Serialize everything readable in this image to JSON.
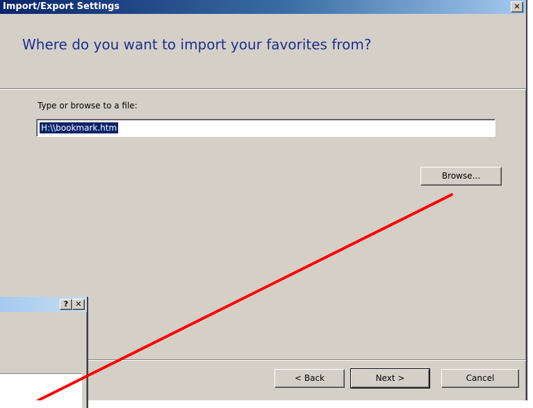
{
  "dialog": {
    "title": "Import/Export Settings",
    "close_glyph": "✕",
    "header_question": "Where do you want to import your favorites from?",
    "field_label": "Type or browse to a file:",
    "path_value": "H:\\\\bookmark.htm",
    "browse_label": "Browse...",
    "back_label": "< Back",
    "next_label": "Next >",
    "cancel_label": "Cancel"
  },
  "overlay_dialog": {
    "help_glyph": "?",
    "close_glyph": "✕"
  },
  "colors": {
    "title_bar": "#0a246a",
    "dialog_face": "#d4d0c8",
    "header_text": "#1f2e8f",
    "selection": "#0a246a",
    "annotation_arrow": "#ff0000"
  },
  "icons": [
    "close-icon",
    "help-icon"
  ]
}
